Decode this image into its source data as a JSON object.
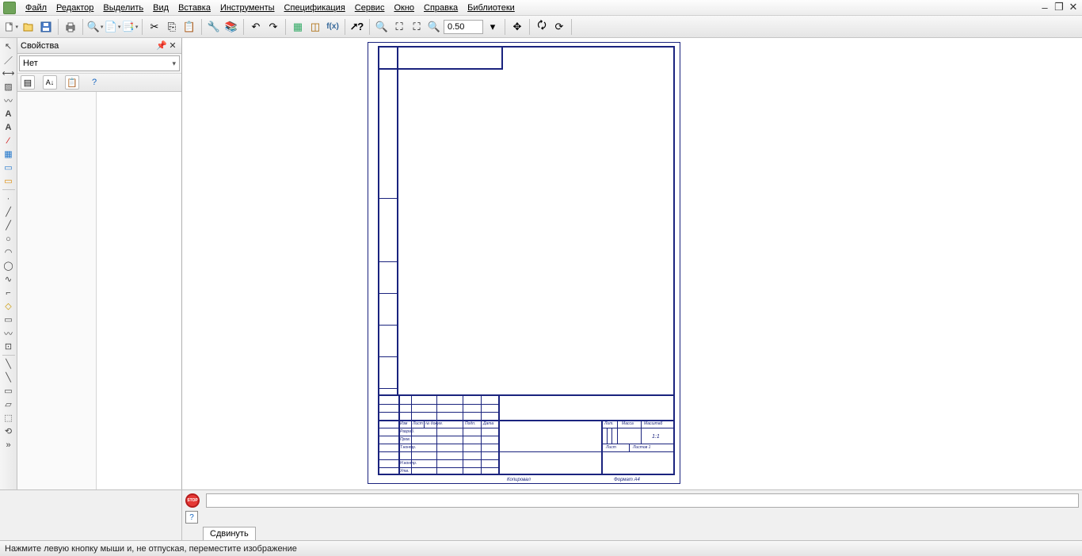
{
  "menu": {
    "items": [
      "Файл",
      "Редактор",
      "Выделить",
      "Вид",
      "Вставка",
      "Инструменты",
      "Спецификация",
      "Сервис",
      "Окно",
      "Справка",
      "Библиотеки"
    ]
  },
  "toolbar": {
    "zoom_value": "0.50"
  },
  "props": {
    "title": "Свойства",
    "select_value": "Нет"
  },
  "titleblock": {
    "row_labels": [
      "Изм",
      "Лист",
      "№ докум.",
      "Подп.",
      "Дата"
    ],
    "rows": [
      "Разраб.",
      "Пров.",
      "Т.контр.",
      "Н.контр.",
      "Утв."
    ],
    "head": [
      "Лит.",
      "Масса",
      "Масштаб"
    ],
    "scale": "1:1",
    "sheet": "Лист",
    "sheets": "Листов   1"
  },
  "footer": {
    "copy": "Копировал",
    "format": "Формат    А4"
  },
  "command": {
    "tab": "Сдвинуть",
    "stop_label": "STOP"
  },
  "status": {
    "text": "Нажмите левую кнопку мыши и, не отпуская, переместите изображение"
  }
}
